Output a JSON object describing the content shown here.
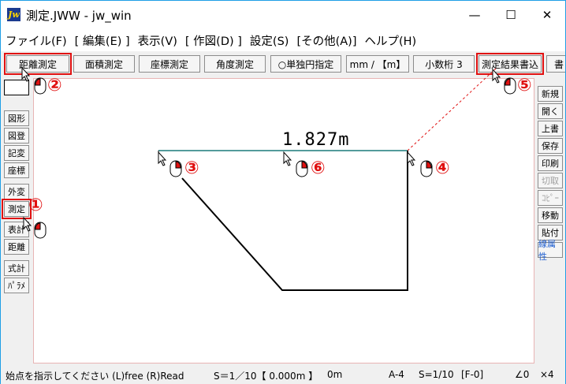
{
  "window": {
    "title": "測定.JWW - jw_win",
    "app_icon": "Jw",
    "minimize": "—",
    "maximize": "☐",
    "close": "✕"
  },
  "menu": [
    "ファイル(F)",
    "[ 編集(E) ]",
    "表示(V)",
    "[ 作図(D) ]",
    "設定(S)",
    "[その他(A)]",
    "ヘルプ(H)"
  ],
  "toolbar": [
    "距離測定",
    "面積測定",
    "座標測定",
    "角度測定",
    "○単独円指定",
    "mm / 【m】",
    "小数桁 3",
    "測定結果書込",
    "書"
  ],
  "left_tools": [
    "図形",
    "図登",
    "記変",
    "座標",
    "外変",
    "測定",
    "表計",
    "距離",
    "式計",
    "ﾊﾟﾗﾒ"
  ],
  "right_tools": [
    "新規",
    "開く",
    "上書",
    "保存",
    "印刷",
    "切取",
    "ｺﾋﾟｰ",
    "移動",
    "貼付",
    "線属性"
  ],
  "measurement": "1.827m",
  "markers": [
    "①",
    "②",
    "③",
    "④",
    "⑤",
    "⑥"
  ],
  "status": {
    "prompt": "始点を指示してください (L)free (R)Read",
    "scale": "S＝1／10【 0.000m 】",
    "zero": "0m",
    "paper": "A-4",
    "scale2": "S=1/10",
    "layer": "[F-0]",
    "angle": "∠0",
    "x": "×4"
  },
  "colors": {
    "highlight": "#e01010",
    "accent": "#1f9fe6"
  }
}
